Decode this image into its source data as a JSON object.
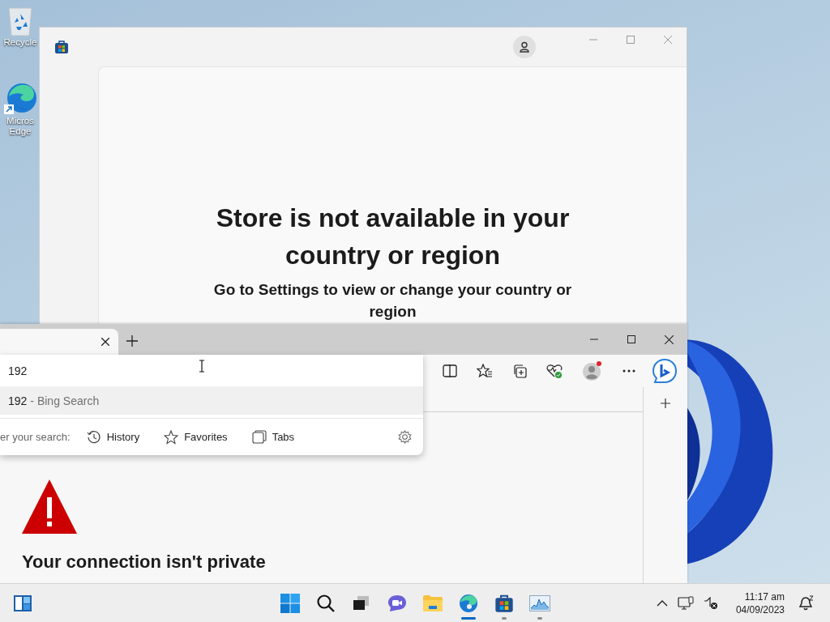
{
  "desktop_icons": [
    {
      "kind": "recycle-bin",
      "lines": [
        "Recycle"
      ]
    },
    {
      "kind": "edge-shortcut",
      "lines": [
        "Micros",
        "Edge"
      ]
    }
  ],
  "store_window": {
    "heading": "Store is not available in your country or region",
    "message": "Go to Settings to view or change your country or region"
  },
  "browser": {
    "address_dropdown": {
      "value": "192",
      "suggestions": [
        {
          "query": "192",
          "source": "- Bing Search",
          "selected": true
        }
      ],
      "filter_label": "er your search:",
      "filters": [
        {
          "kind": "history",
          "label": "History"
        },
        {
          "kind": "favorites",
          "label": "Favorites"
        },
        {
          "kind": "tabs",
          "label": "Tabs"
        }
      ]
    },
    "page": {
      "heading": "Your connection isn't private"
    }
  },
  "taskbar": {
    "apps": [
      {
        "kind": "start",
        "active": false,
        "running": false
      },
      {
        "kind": "search",
        "active": false,
        "running": false
      },
      {
        "kind": "task-view",
        "active": false,
        "running": false
      },
      {
        "kind": "chat",
        "active": false,
        "running": false
      },
      {
        "kind": "explorer",
        "active": false,
        "running": false
      },
      {
        "kind": "edge",
        "active": true,
        "running": true
      },
      {
        "kind": "store",
        "active": false,
        "running": true
      },
      {
        "kind": "monitor",
        "active": false,
        "running": true
      }
    ],
    "time": "11:17 am",
    "date": "04/09/2023"
  }
}
